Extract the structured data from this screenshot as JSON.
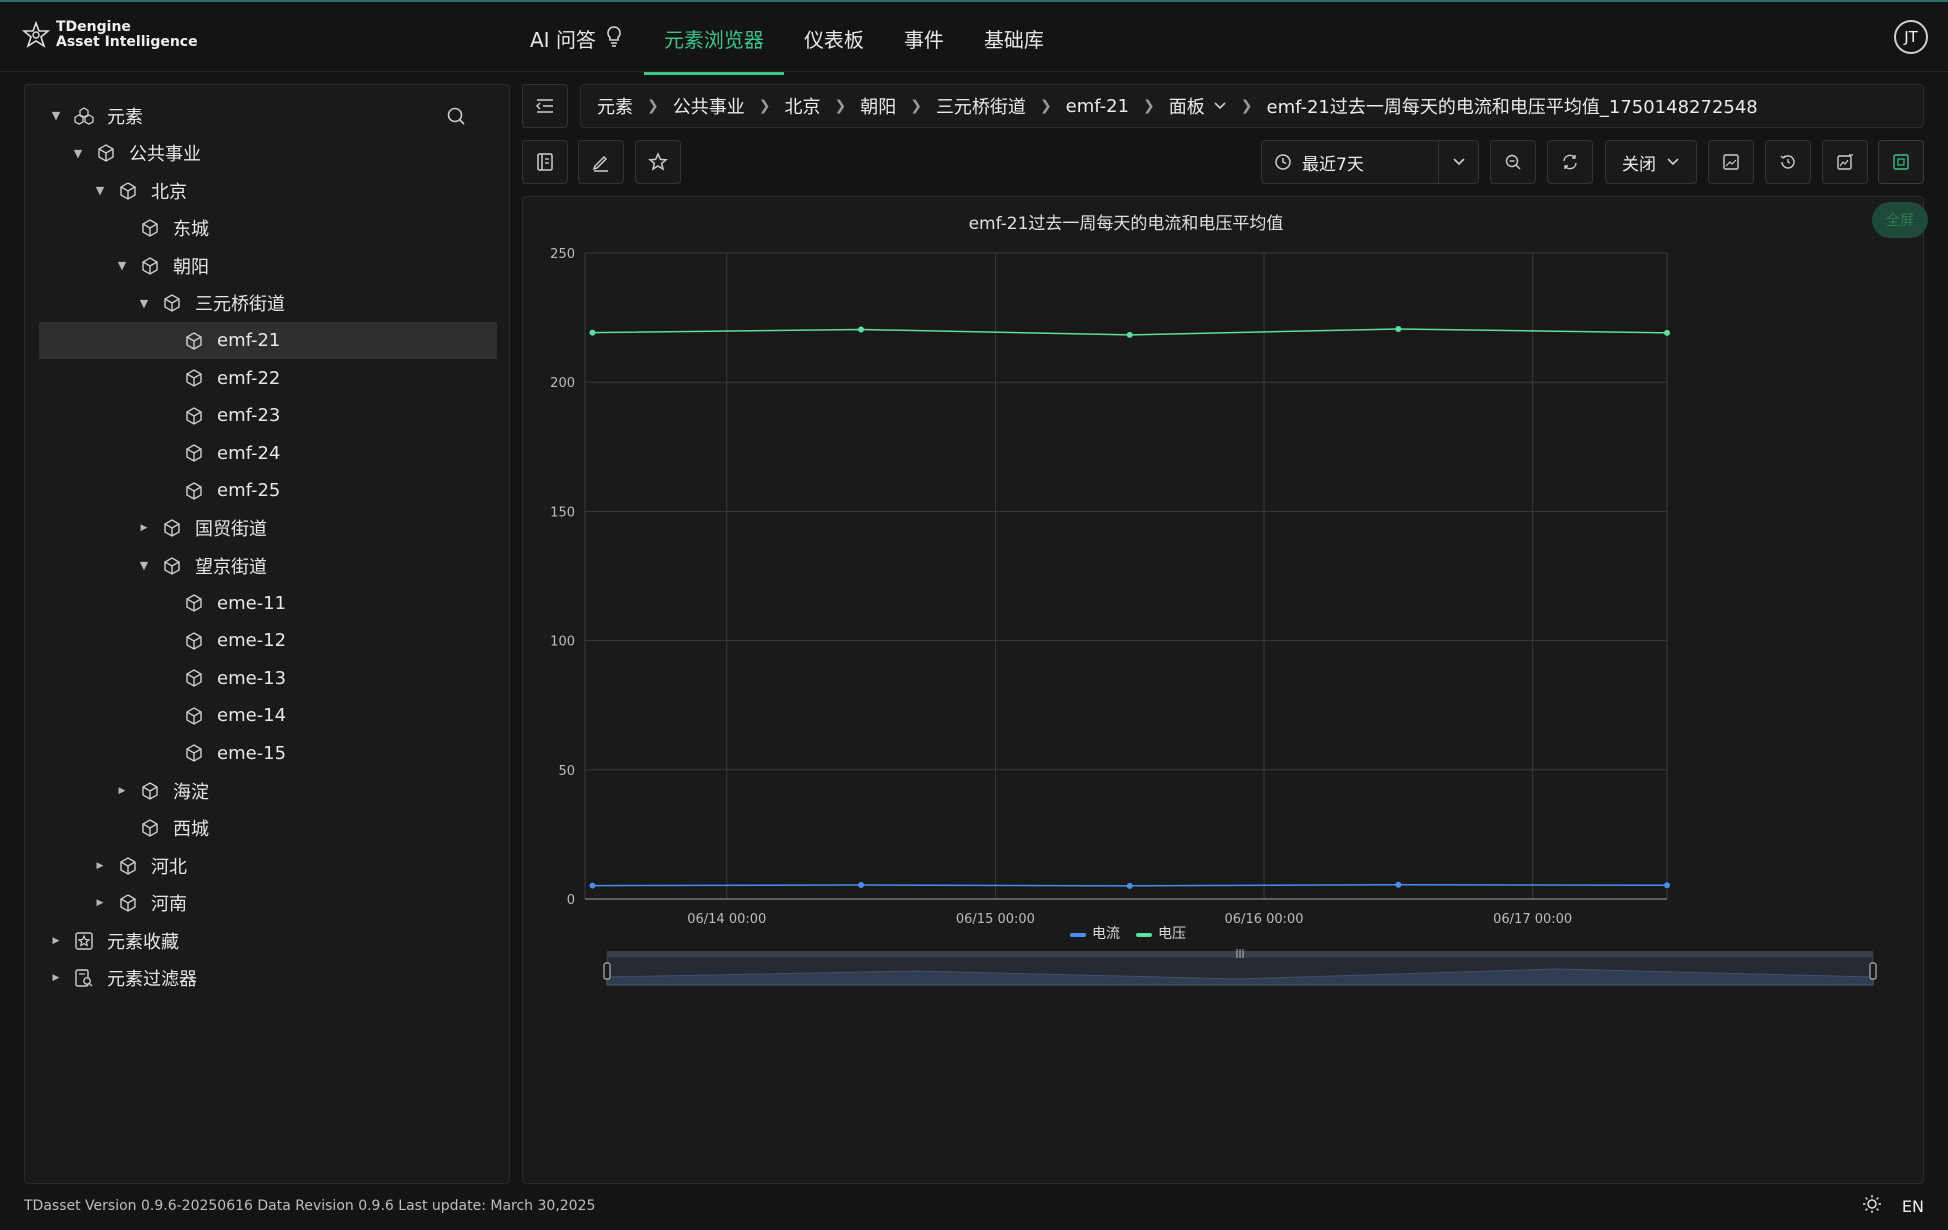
{
  "brand": {
    "line1": "TDengine",
    "line2": "Asset Intelligence"
  },
  "nav": [
    {
      "label": "AI 问答",
      "icon": "bulb-icon",
      "active": false
    },
    {
      "label": "元素浏览器",
      "active": true
    },
    {
      "label": "仪表板",
      "active": false
    },
    {
      "label": "事件",
      "active": false
    },
    {
      "label": "基础库",
      "active": false
    }
  ],
  "user": {
    "initials": "JT"
  },
  "tree": [
    {
      "label": "元素",
      "level": 0,
      "expanded": true,
      "icon": "elements-root-icon"
    },
    {
      "label": "公共事业",
      "level": 1,
      "expanded": true,
      "icon": "cube-icon"
    },
    {
      "label": "北京",
      "level": 2,
      "expanded": true,
      "icon": "cube-icon"
    },
    {
      "label": "东城",
      "level": 3,
      "icon": "cube-icon"
    },
    {
      "label": "朝阳",
      "level": 3,
      "expanded": true,
      "icon": "cube-icon"
    },
    {
      "label": "三元桥街道",
      "level": 4,
      "expanded": true,
      "icon": "cube-icon"
    },
    {
      "label": "emf-21",
      "level": 5,
      "selected": true,
      "icon": "cube-icon"
    },
    {
      "label": "emf-22",
      "level": 5,
      "icon": "cube-icon"
    },
    {
      "label": "emf-23",
      "level": 5,
      "icon": "cube-icon"
    },
    {
      "label": "emf-24",
      "level": 5,
      "icon": "cube-icon"
    },
    {
      "label": "emf-25",
      "level": 5,
      "icon": "cube-icon"
    },
    {
      "label": "国贸街道",
      "level": 4,
      "expanded": false,
      "icon": "cube-icon"
    },
    {
      "label": "望京街道",
      "level": 4,
      "expanded": true,
      "icon": "cube-icon"
    },
    {
      "label": "eme-11",
      "level": 5,
      "icon": "cube-icon"
    },
    {
      "label": "eme-12",
      "level": 5,
      "icon": "cube-icon"
    },
    {
      "label": "eme-13",
      "level": 5,
      "icon": "cube-icon"
    },
    {
      "label": "eme-14",
      "level": 5,
      "icon": "cube-icon"
    },
    {
      "label": "eme-15",
      "level": 5,
      "icon": "cube-icon"
    },
    {
      "label": "海淀",
      "level": 3,
      "expanded": false,
      "icon": "cube-icon"
    },
    {
      "label": "西城",
      "level": 3,
      "icon": "cube-icon"
    },
    {
      "label": "河北",
      "level": 2,
      "expanded": false,
      "icon": "cube-icon"
    },
    {
      "label": "河南",
      "level": 2,
      "expanded": false,
      "icon": "cube-icon"
    },
    {
      "label": "元素收藏",
      "level": 0,
      "expanded": false,
      "icon": "favorites-icon"
    },
    {
      "label": "元素过滤器",
      "level": 0,
      "expanded": false,
      "icon": "filter-icon"
    }
  ],
  "breadcrumb": [
    "元素",
    "公共事业",
    "北京",
    "朝阳",
    "三元桥街道",
    "emf-21",
    "面板",
    "emf-21过去一周每天的电流和电压平均值_1750148272548"
  ],
  "toolbar": {
    "time_range": "最近7天",
    "refresh": "关闭",
    "fullscreen_tip": "全屏"
  },
  "colors": {
    "accent": "#3cc48a",
    "current": "#4a8ef5",
    "voltage": "#5fe0a0"
  },
  "chart_data": {
    "type": "line",
    "title": "emf-21过去一周每天的电流和电压平均值",
    "x": [
      "06/13 12:00",
      "06/14 12:00",
      "06/15 12:00",
      "06/16 12:00",
      "06/17 12:00"
    ],
    "x_ticks": [
      "06/14 00:00",
      "06/15 00:00",
      "06/16 00:00",
      "06/17 00:00"
    ],
    "xlim": [
      "06/13 11:20",
      "06/17 12:00"
    ],
    "ylim": [
      0,
      250
    ],
    "y_ticks": [
      0,
      50,
      100,
      150,
      200,
      250
    ],
    "grid": true,
    "legend_position": "bottom",
    "series": [
      {
        "name": "电流",
        "values": [
          5.2,
          5.4,
          5.1,
          5.5,
          5.3
        ]
      },
      {
        "name": "电压",
        "values": [
          219.2,
          220.4,
          218.3,
          220.6,
          219.1
        ]
      }
    ]
  },
  "footer": {
    "version": "TDasset Version 0.9.6-20250616 Data Revision 0.9.6 Last update: March 30,2025",
    "lang": "EN"
  }
}
